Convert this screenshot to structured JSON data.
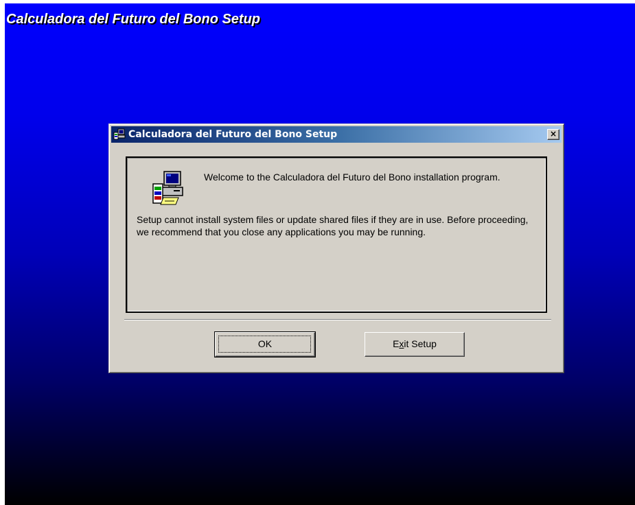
{
  "desktop": {
    "banner_title": "Calculadora del Futuro del Bono Setup",
    "gradient_colors": [
      "#0000fe",
      "#0000b8",
      "#000000"
    ]
  },
  "dialog": {
    "title": "Calculadora del Futuro del Bono Setup",
    "close_label": "×",
    "icon": "setup-computer-icon",
    "welcome_text": "Welcome to the Calculadora del Futuro del Bono installation program.",
    "warning_text": "Setup cannot install system files or update shared files if they are in use. Before proceeding, we recommend that you close any applications you may be running.",
    "buttons": {
      "ok_label": "OK",
      "exit_label_pre": "E",
      "exit_label_mnemonic": "x",
      "exit_label_post": "it Setup"
    },
    "colors": {
      "face": "#d4d0c8",
      "titlebar_start": "#0a246a",
      "titlebar_end": "#a6caf0"
    }
  }
}
